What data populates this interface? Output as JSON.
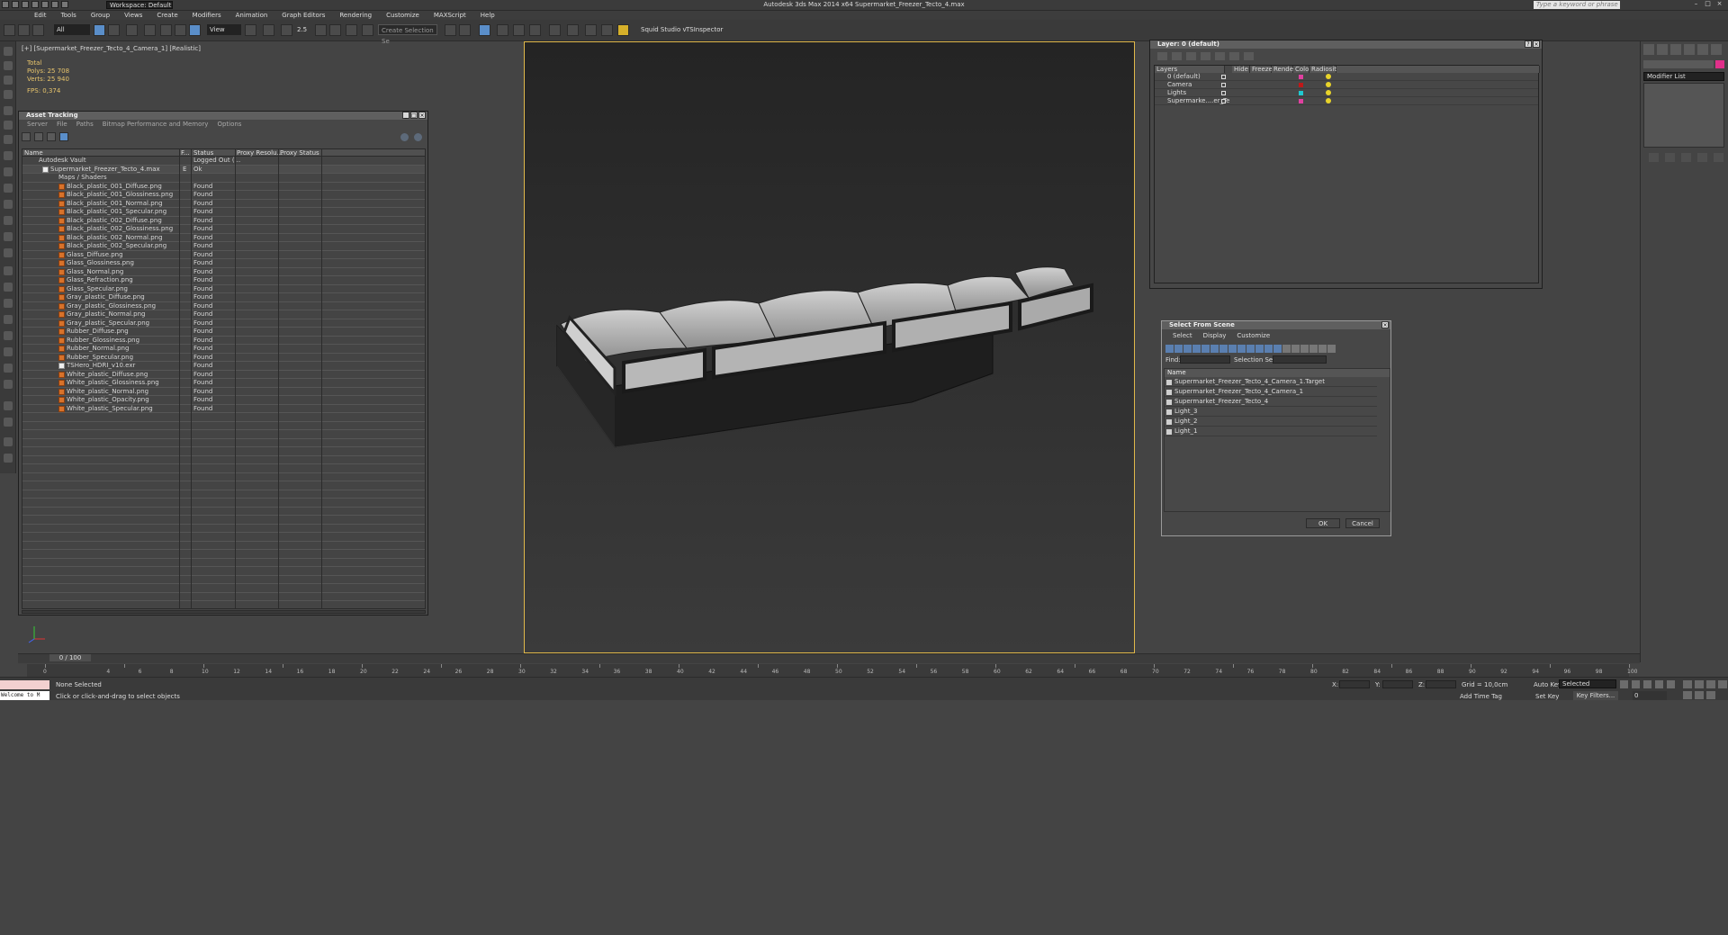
{
  "app": {
    "title": "Autodesk 3ds Max  2014 x64     Supermarket_Freezer_Tecto_4.max",
    "workspace": "Workspace: Default",
    "search_placeholder": "Type a keyword or phrase"
  },
  "menu": [
    "Edit",
    "Tools",
    "Group",
    "Views",
    "Create",
    "Modifiers",
    "Animation",
    "Graph Editors",
    "Rendering",
    "Customize",
    "MAXScript",
    "Help"
  ],
  "toolbar": {
    "selection_filter": "All",
    "view_ref": "View",
    "snap_value": "2.5",
    "named_selection": "Create Selection Se",
    "squid": "Squid Studio v",
    "tsinspector": "TSInspector"
  },
  "viewport": {
    "label": "[+] [Supermarket_Freezer_Tecto_4_Camera_1] [Realistic]",
    "stats": {
      "total": "Total",
      "polys_k": "Polys:",
      "polys_v": "25 708",
      "verts_k": "Verts:",
      "verts_v": "25 940",
      "fps_k": "FPS:",
      "fps_v": "0,374"
    }
  },
  "asset_tracking": {
    "title": "Asset Tracking",
    "menu": [
      "Server",
      "File",
      "Paths",
      "Bitmap Performance and Memory",
      "Options"
    ],
    "columns": [
      "Name",
      "F...",
      "Status",
      "Proxy Resolu...",
      "Proxy Status"
    ],
    "vault": {
      "name": "Autodesk Vault",
      "status": "Logged Out (..."
    },
    "scene_file": {
      "name": "Supermarket_Freezer_Tecto_4.max",
      "f": "E",
      "status": "Ok"
    },
    "maps_group": "Maps / Shaders",
    "files": [
      {
        "name": "Black_plastic_001_Diffuse.png",
        "status": "Found"
      },
      {
        "name": "Black_plastic_001_Glossiness.png",
        "status": "Found"
      },
      {
        "name": "Black_plastic_001_Normal.png",
        "status": "Found"
      },
      {
        "name": "Black_plastic_001_Specular.png",
        "status": "Found"
      },
      {
        "name": "Black_plastic_002_Diffuse.png",
        "status": "Found"
      },
      {
        "name": "Black_plastic_002_Glossiness.png",
        "status": "Found"
      },
      {
        "name": "Black_plastic_002_Normal.png",
        "status": "Found"
      },
      {
        "name": "Black_plastic_002_Specular.png",
        "status": "Found"
      },
      {
        "name": "Glass_Diffuse.png",
        "status": "Found"
      },
      {
        "name": "Glass_Glossiness.png",
        "status": "Found"
      },
      {
        "name": "Glass_Normal.png",
        "status": "Found"
      },
      {
        "name": "Glass_Refraction.png",
        "status": "Found"
      },
      {
        "name": "Glass_Specular.png",
        "status": "Found"
      },
      {
        "name": "Gray_plastic_Diffuse.png",
        "status": "Found"
      },
      {
        "name": "Gray_plastic_Glossiness.png",
        "status": "Found"
      },
      {
        "name": "Gray_plastic_Normal.png",
        "status": "Found"
      },
      {
        "name": "Gray_plastic_Specular.png",
        "status": "Found"
      },
      {
        "name": "Rubber_Diffuse.png",
        "status": "Found"
      },
      {
        "name": "Rubber_Glossiness.png",
        "status": "Found"
      },
      {
        "name": "Rubber_Normal.png",
        "status": "Found"
      },
      {
        "name": "Rubber_Specular.png",
        "status": "Found"
      },
      {
        "name": "TSHero_HDRI_v10.exr",
        "status": "Found"
      },
      {
        "name": "White_plastic_Diffuse.png",
        "status": "Found"
      },
      {
        "name": "White_plastic_Glossiness.png",
        "status": "Found"
      },
      {
        "name": "White_plastic_Normal.png",
        "status": "Found"
      },
      {
        "name": "White_plastic_Opacity.png",
        "status": "Found"
      },
      {
        "name": "White_plastic_Specular.png",
        "status": "Found"
      }
    ]
  },
  "layers": {
    "title": "Layer: 0 (default)",
    "columns": [
      "Layers",
      "Hide",
      "Freeze",
      "Render",
      "Color",
      "Radiosity"
    ],
    "rows": [
      {
        "name": "0 (default)",
        "color": "#e040a0"
      },
      {
        "name": "Camera",
        "color": "#c01818"
      },
      {
        "name": "Lights",
        "color": "#20c8d0"
      },
      {
        "name": "Supermarke....er_Te",
        "color": "#e040a0"
      }
    ]
  },
  "select_from_scene": {
    "title": "Select From Scene",
    "menu": [
      "Select",
      "Display",
      "Customize"
    ],
    "find_label": "Find:",
    "selset_label": "Selection Set:",
    "name_header": "Name",
    "items": [
      "Supermarket_Freezer_Tecto_4_Camera_1.Target",
      "Supermarket_Freezer_Tecto_4_Camera_1",
      "Supermarket_Freezer_Tecto_4",
      "Light_3",
      "Light_2",
      "Light_1"
    ],
    "ok": "OK",
    "cancel": "Cancel"
  },
  "modifier_list": "Modifier List",
  "timeline": {
    "frame": "0 / 100",
    "ticks": [
      "0",
      "4",
      "6",
      "8",
      "10",
      "12",
      "14",
      "16",
      "18",
      "20",
      "22",
      "24",
      "26",
      "28",
      "30",
      "32",
      "34",
      "36",
      "38",
      "40",
      "42",
      "44",
      "46",
      "48",
      "50",
      "52",
      "54",
      "56",
      "58",
      "60",
      "62",
      "64",
      "66",
      "68",
      "70",
      "72",
      "74",
      "76",
      "78",
      "80",
      "82",
      "84",
      "86",
      "88",
      "90",
      "92",
      "94",
      "96",
      "98",
      "100"
    ]
  },
  "status": {
    "listener": "Welcome to M",
    "none_selected": "None Selected",
    "prompt": "Click or click-and-drag to select objects",
    "x_label": "X:",
    "y_label": "Y:",
    "z_label": "Z:",
    "grid": "Grid = 10,0cm",
    "add_time_tag": "Add Time Tag",
    "auto_key": "Auto Key",
    "set_key": "Set Key",
    "selected": "Selected",
    "key_filters": "Key Filters...",
    "current_frame": "0"
  },
  "colors": {
    "accent": "#5a8ec9",
    "viewport_border": "#e0b84a",
    "found": "#d8722a"
  }
}
